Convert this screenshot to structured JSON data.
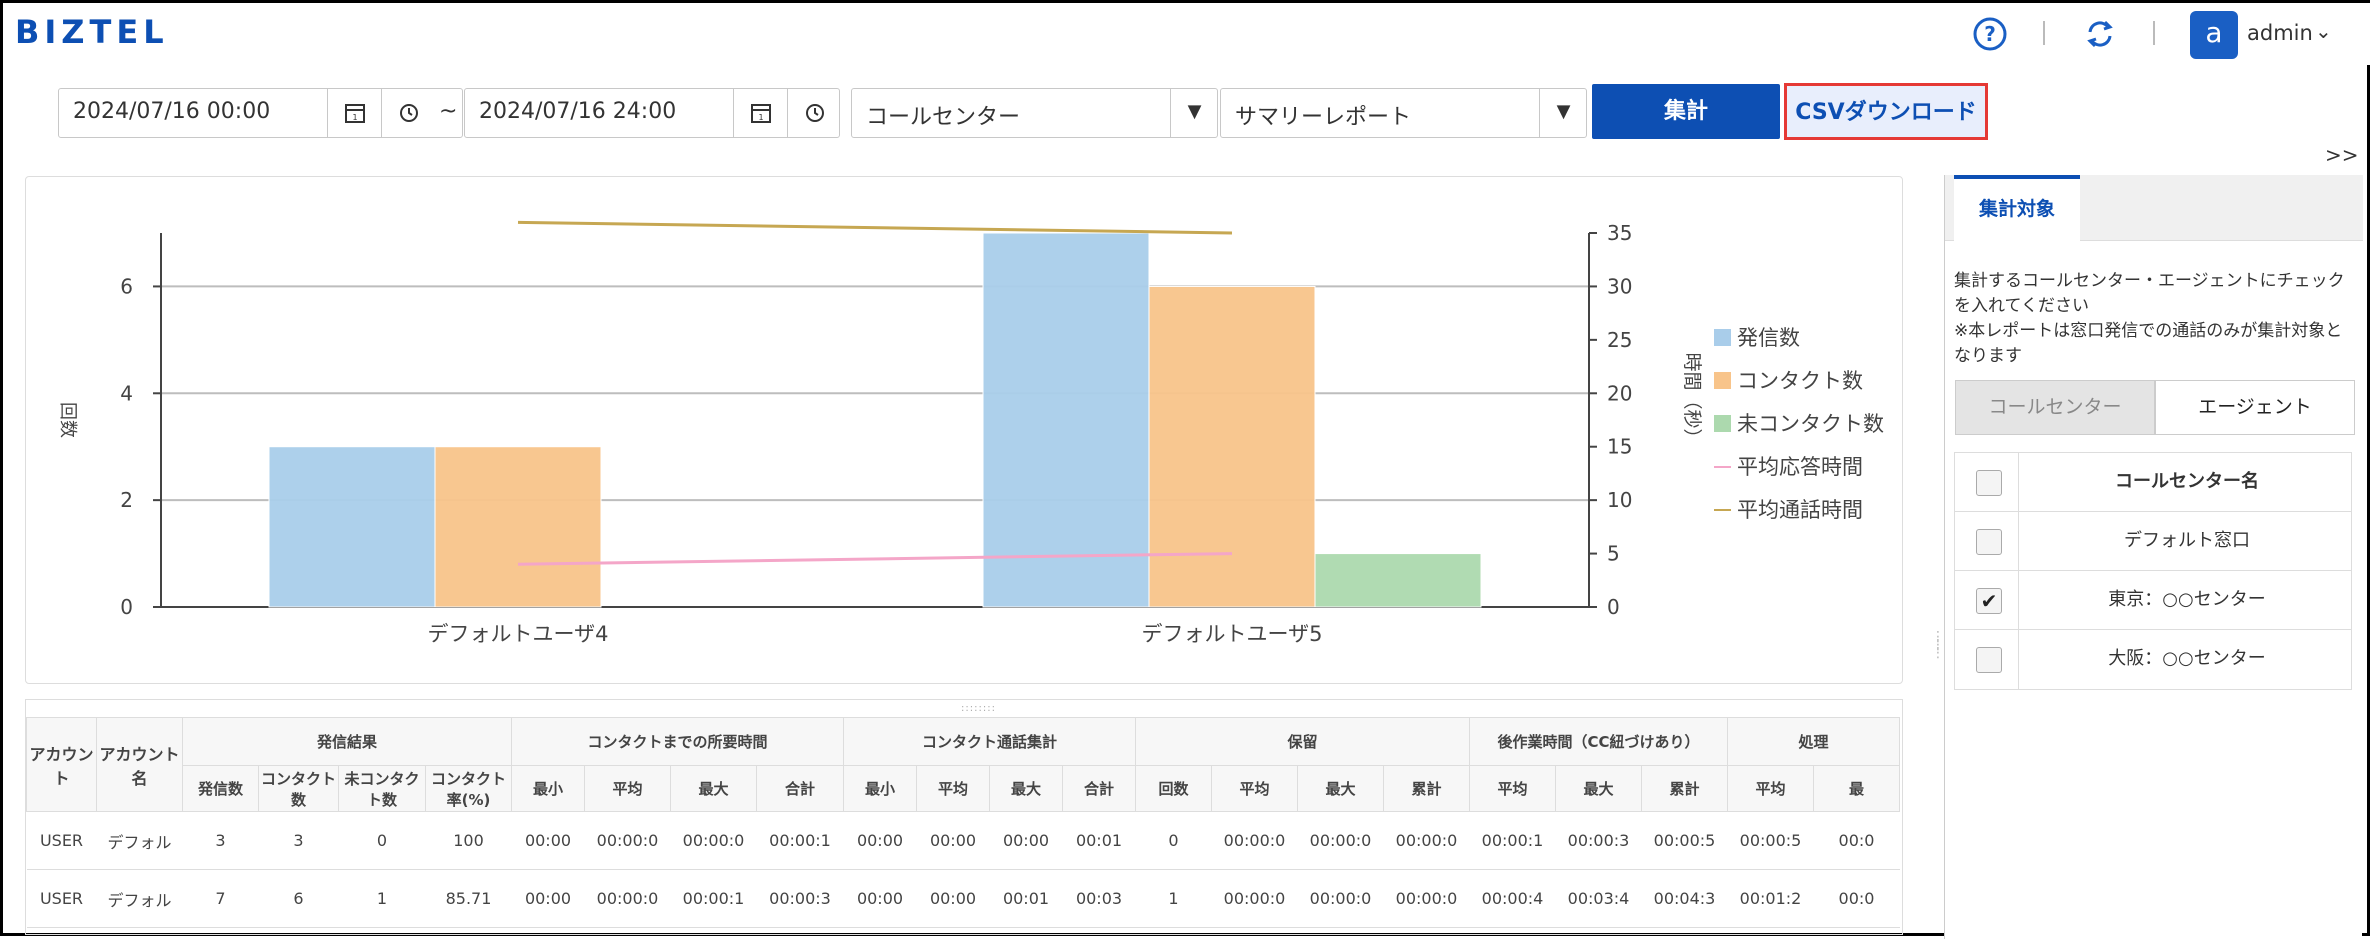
{
  "header": {
    "logo": "BIZTEL",
    "help_icon": "question-circle-icon",
    "refresh_icon": "refresh-icon",
    "avatar_letter": "a",
    "username": "admin"
  },
  "filters": {
    "start_datetime": "2024/07/16 00:00",
    "end_datetime": "2024/07/16 24:00",
    "range_separator": "~",
    "callcenter_select": "コールセンター",
    "report_select": "サマリーレポート",
    "aggregate_button": "集計",
    "csv_button": "CSVダウンロード",
    "collapse_label": ">>"
  },
  "chart_data": {
    "type": "bar",
    "categories": [
      "デフォルトユーザ4",
      "デフォルトユーザ5"
    ],
    "ylabel": "回数",
    "y2label": "時間（秒）",
    "ylim": [
      0,
      7
    ],
    "y2lim": [
      0,
      35
    ],
    "yticks": [
      0,
      2,
      4,
      6
    ],
    "y2ticks": [
      0,
      5,
      10,
      15,
      20,
      25,
      30,
      35
    ],
    "series": [
      {
        "name": "発信数",
        "type": "bar",
        "axis": "left",
        "color": "#a9cdea",
        "values": [
          3,
          7
        ]
      },
      {
        "name": "コンタクト数",
        "type": "bar",
        "axis": "left",
        "color": "#f8c48a",
        "values": [
          3,
          6
        ]
      },
      {
        "name": "未コンタクト数",
        "type": "bar",
        "axis": "left",
        "color": "#acd9ae",
        "values": [
          0,
          1
        ]
      },
      {
        "name": "平均応答時間",
        "type": "line",
        "axis": "right",
        "color": "#f4a6c8",
        "values": [
          4,
          5
        ]
      },
      {
        "name": "平均通話時間",
        "type": "line",
        "axis": "right",
        "color": "#c6a752",
        "values": [
          36,
          35
        ]
      }
    ]
  },
  "table": {
    "groups": [
      {
        "label": "アカウント",
        "rowspan": 2
      },
      {
        "label": "アカウント名",
        "rowspan": 2
      },
      {
        "label": "発信結果",
        "cols": [
          "発信数",
          "コンタクト数",
          "未コンタクト数",
          "コンタクト率(%)"
        ]
      },
      {
        "label": "コンタクトまでの所要時間",
        "cols": [
          "最小",
          "平均",
          "最大",
          "合計"
        ]
      },
      {
        "label": "コンタクト通話集計",
        "cols": [
          "最小",
          "平均",
          "最大",
          "合計"
        ]
      },
      {
        "label": "保留",
        "cols": [
          "回数",
          "平均",
          "最大",
          "累計"
        ]
      },
      {
        "label": "後作業時間（CC紐づけあり）",
        "cols": [
          "平均",
          "最大",
          "累計"
        ]
      },
      {
        "label": "処理",
        "cols": [
          "平均",
          "最"
        ]
      }
    ],
    "rows": [
      [
        "USER",
        "デフォル",
        "3",
        "3",
        "0",
        "100",
        "00:00",
        "00:00:0",
        "00:00:0",
        "00:00:1",
        "00:00",
        "00:00",
        "00:00",
        "00:01",
        "0",
        "00:00:0",
        "00:00:0",
        "00:00:0",
        "00:00:1",
        "00:00:3",
        "00:00:5",
        "00:00:5",
        "00:0"
      ],
      [
        "USER",
        "デフォル",
        "7",
        "6",
        "1",
        "85.71",
        "00:00",
        "00:00:0",
        "00:00:1",
        "00:00:3",
        "00:00",
        "00:00",
        "00:01",
        "00:03",
        "1",
        "00:00:0",
        "00:00:0",
        "00:00:0",
        "00:00:4",
        "00:03:4",
        "00:04:3",
        "00:01:2",
        "00:0"
      ]
    ]
  },
  "panel": {
    "tab_label": "集計対象",
    "description": "集計するコールセンター・エージェントにチェックを入れてください\n※本レポートは窓口発信での通話のみが集計対象となります",
    "segment_callcenter": "コールセンター",
    "segment_agent": "エージェント",
    "column_header": "コールセンター名",
    "centers": [
      {
        "name": "デフォルト窓口",
        "checked": false
      },
      {
        "name": "東京：○○センター",
        "checked": true
      },
      {
        "name": "大阪：○○センター",
        "checked": false
      }
    ]
  }
}
